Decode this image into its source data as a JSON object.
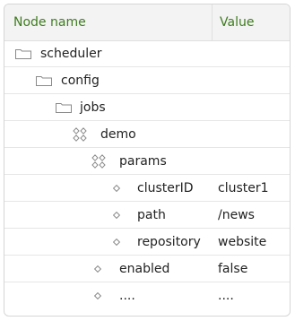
{
  "table": {
    "columns": {
      "name": "Node name",
      "value": "Value"
    },
    "rows": [
      {
        "icon": "folder-icon",
        "label": "scheduler",
        "value": ""
      },
      {
        "icon": "folder-icon",
        "label": "config",
        "value": ""
      },
      {
        "icon": "folder-icon",
        "label": "jobs",
        "value": ""
      },
      {
        "icon": "node-group-icon",
        "label": "demo",
        "value": ""
      },
      {
        "icon": "node-group-icon",
        "label": "params",
        "value": ""
      },
      {
        "icon": "property-icon",
        "label": "clusterID",
        "value": "cluster1"
      },
      {
        "icon": "property-icon",
        "label": "path",
        "value": "/news"
      },
      {
        "icon": "property-icon",
        "label": "repository",
        "value": "website"
      },
      {
        "icon": "property-icon",
        "label": "enabled",
        "value": "false"
      },
      {
        "icon": "property-icon",
        "label": "....",
        "value": "...."
      }
    ]
  },
  "colors": {
    "header_text": "#3e7c1e",
    "header_bg": "#f3f3f3",
    "border": "#d6d6d6"
  }
}
